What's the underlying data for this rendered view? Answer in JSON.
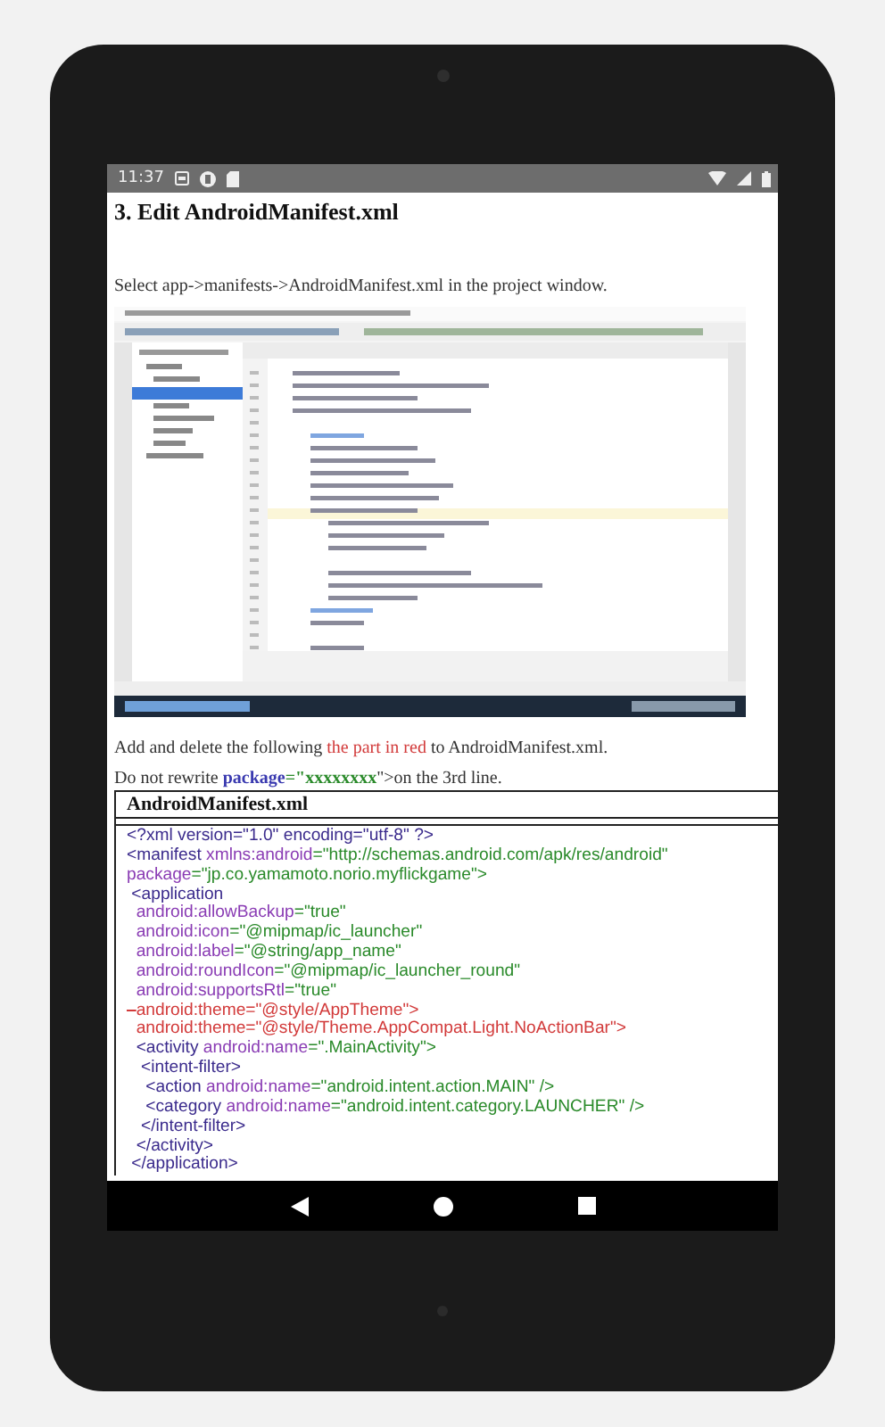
{
  "status_bar": {
    "time": "11:37"
  },
  "article": {
    "heading": "3. Edit AndroidManifest.xml",
    "intro": "Select app->manifests->AndroidManifest.xml in the project window.",
    "instructions": [
      {
        "segments": [
          {
            "text": "Add and delete the following ",
            "kind": "plain"
          },
          {
            "text": "the part in red",
            "kind": "red"
          },
          {
            "text": " to AndroidManifest.xml.",
            "kind": "plain"
          }
        ]
      },
      {
        "segments": [
          {
            "text": "Do not rewrite ",
            "kind": "plain"
          },
          {
            "text": "package",
            "kind": "attr"
          },
          {
            "text": "=\"",
            "kind": "value"
          },
          {
            "text": "xxxxxxxx",
            "kind": "value"
          },
          {
            "text": "\">on the 3rd line.",
            "kind": "plain"
          }
        ]
      }
    ],
    "code_box": {
      "title": "AndroidManifest.xml",
      "lines": [
        {
          "segments": [
            {
              "text": "<?xml version=\"1.0\" encoding=\"utf-8\" ?>",
              "kind": "tag"
            }
          ]
        },
        {
          "segments": [
            {
              "text": "<manifest ",
              "kind": "tag"
            },
            {
              "text": "xmlns:android",
              "kind": "attr"
            },
            {
              "text": "=\"http://schemas.android.com/apk/res/android\"",
              "kind": "value"
            }
          ]
        },
        {
          "segments": [
            {
              "text": "package",
              "kind": "attr"
            },
            {
              "text": "=\"jp.co.yamamoto.norio.myflickgame\">",
              "kind": "value"
            }
          ]
        },
        {
          "segments": [
            {
              "text": " <application",
              "kind": "tag"
            }
          ]
        },
        {
          "segments": [
            {
              "text": "  android:allowBackup",
              "kind": "attr"
            },
            {
              "text": "=\"true\"",
              "kind": "value"
            }
          ]
        },
        {
          "segments": [
            {
              "text": "  android:icon",
              "kind": "attr"
            },
            {
              "text": "=\"@mipmap/ic_launcher\"",
              "kind": "value"
            }
          ]
        },
        {
          "segments": [
            {
              "text": "  android:label",
              "kind": "attr"
            },
            {
              "text": "=\"@string/app_name\"",
              "kind": "value"
            }
          ]
        },
        {
          "segments": [
            {
              "text": "  android:roundIcon",
              "kind": "attr"
            },
            {
              "text": "=\"@mipmap/ic_launcher_round\"",
              "kind": "value"
            }
          ]
        },
        {
          "segments": [
            {
              "text": "  android:supportsRtl",
              "kind": "attr"
            },
            {
              "text": "=\"true\"",
              "kind": "value"
            }
          ]
        },
        {
          "segments": [
            {
              "text": "  android:theme=\"@style/AppTheme\">",
              "kind": "deleted"
            }
          ]
        },
        {
          "segments": [
            {
              "text": "  android:theme=\"@style/Theme.AppCompat.Light.NoActionBar\">",
              "kind": "inserted"
            }
          ]
        },
        {
          "segments": [
            {
              "text": "  <activity ",
              "kind": "tag"
            },
            {
              "text": "android:name",
              "kind": "attr"
            },
            {
              "text": "=\".MainActivity\">",
              "kind": "value"
            }
          ]
        },
        {
          "segments": [
            {
              "text": "   <intent-filter>",
              "kind": "tag"
            }
          ]
        },
        {
          "segments": [
            {
              "text": "    <action ",
              "kind": "tag"
            },
            {
              "text": "android:name",
              "kind": "attr"
            },
            {
              "text": "=\"android.intent.action.MAIN\" />",
              "kind": "value"
            }
          ]
        },
        {
          "segments": [
            {
              "text": "    <category ",
              "kind": "tag"
            },
            {
              "text": "android:name",
              "kind": "attr"
            },
            {
              "text": "=\"android.intent.category.LAUNCHER\" />",
              "kind": "value"
            }
          ]
        },
        {
          "segments": [
            {
              "text": "   </intent-filter>",
              "kind": "tag"
            }
          ]
        },
        {
          "segments": [
            {
              "text": "  </activity>",
              "kind": "tag"
            }
          ]
        },
        {
          "segments": [
            {
              "text": " </application>",
              "kind": "tag"
            }
          ]
        }
      ]
    }
  }
}
